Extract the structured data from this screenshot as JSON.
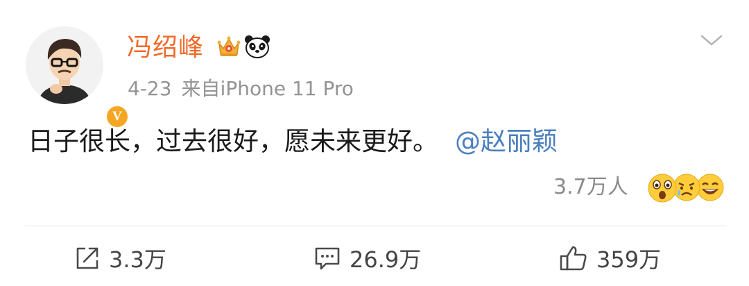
{
  "post": {
    "author": "冯绍峰",
    "date": "4-23",
    "source": "来自iPhone 11 Pro",
    "text": "日子很长，过去很好，愿未来更好。",
    "mention": "@赵丽颖",
    "reaction_count": "3.7万人"
  },
  "actions": {
    "repost": "3.3万",
    "comment": "26.9万",
    "like": "359万"
  },
  "badges": [
    "crown-icon",
    "panda-icon",
    "verified-v-icon"
  ],
  "colors": {
    "author": "#f06a2a",
    "mention": "#4a7fbf",
    "meta": "#939393",
    "verified": "#f5a623"
  },
  "verified_badge": "V"
}
